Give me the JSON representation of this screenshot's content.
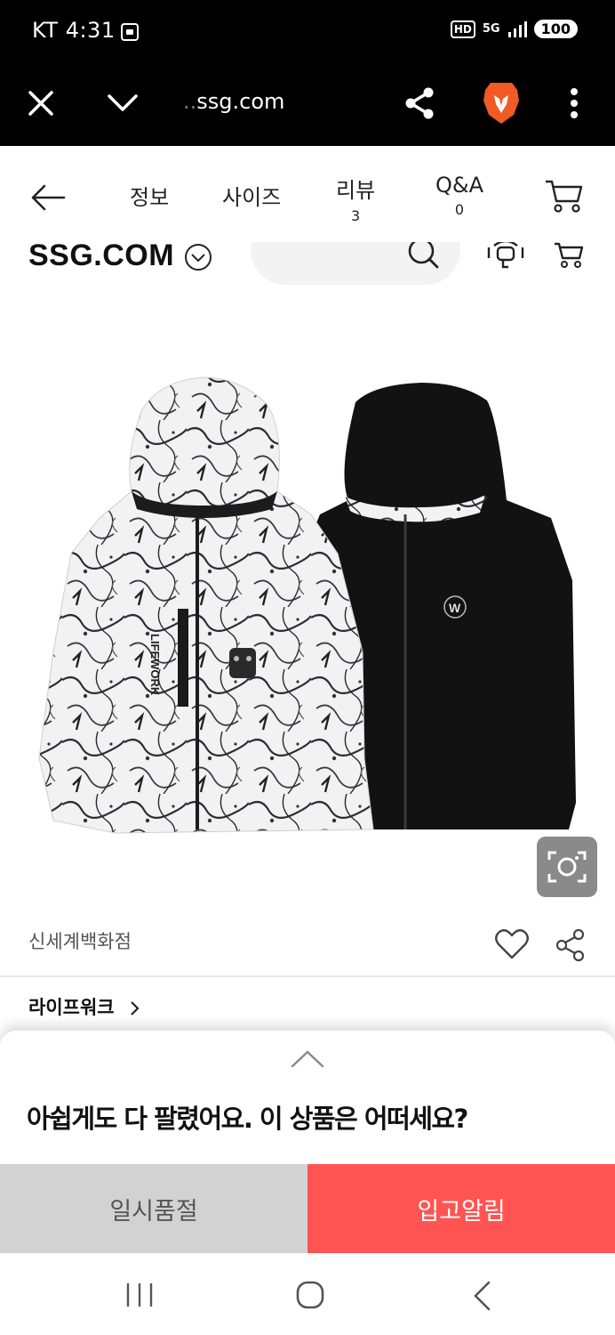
{
  "status_bar": {
    "carrier": "KT",
    "time": "4:31",
    "hd": "HD",
    "network": "5G",
    "battery": "100"
  },
  "browser": {
    "url_prefix": "..",
    "url_domain": "ssg.com",
    "icons": [
      "close-icon",
      "chevron-down-icon",
      "share-icon",
      "brave-lion-icon",
      "more-vertical-icon"
    ]
  },
  "tabs": [
    {
      "label": "정보",
      "count": ""
    },
    {
      "label": "사이즈",
      "count": ""
    },
    {
      "label": "리뷰",
      "count": "3"
    },
    {
      "label": "Q&A",
      "count": "0"
    }
  ],
  "site_header": {
    "logo": "SSG.COM"
  },
  "product": {
    "seller": "신세계백화점",
    "brand_link": "라이프워크",
    "image_print_left": "LIFEWORK"
  },
  "sheet": {
    "message": "아쉽게도 다 팔렸어요. 이 상품은 어떠세요?"
  },
  "actions": {
    "soldout_label": "일시품절",
    "alert_label": "입고알림"
  },
  "colors": {
    "alert_button": "#ff5452",
    "soldout_button": "#d2d2d2",
    "brave_orange": "#f05a24"
  }
}
